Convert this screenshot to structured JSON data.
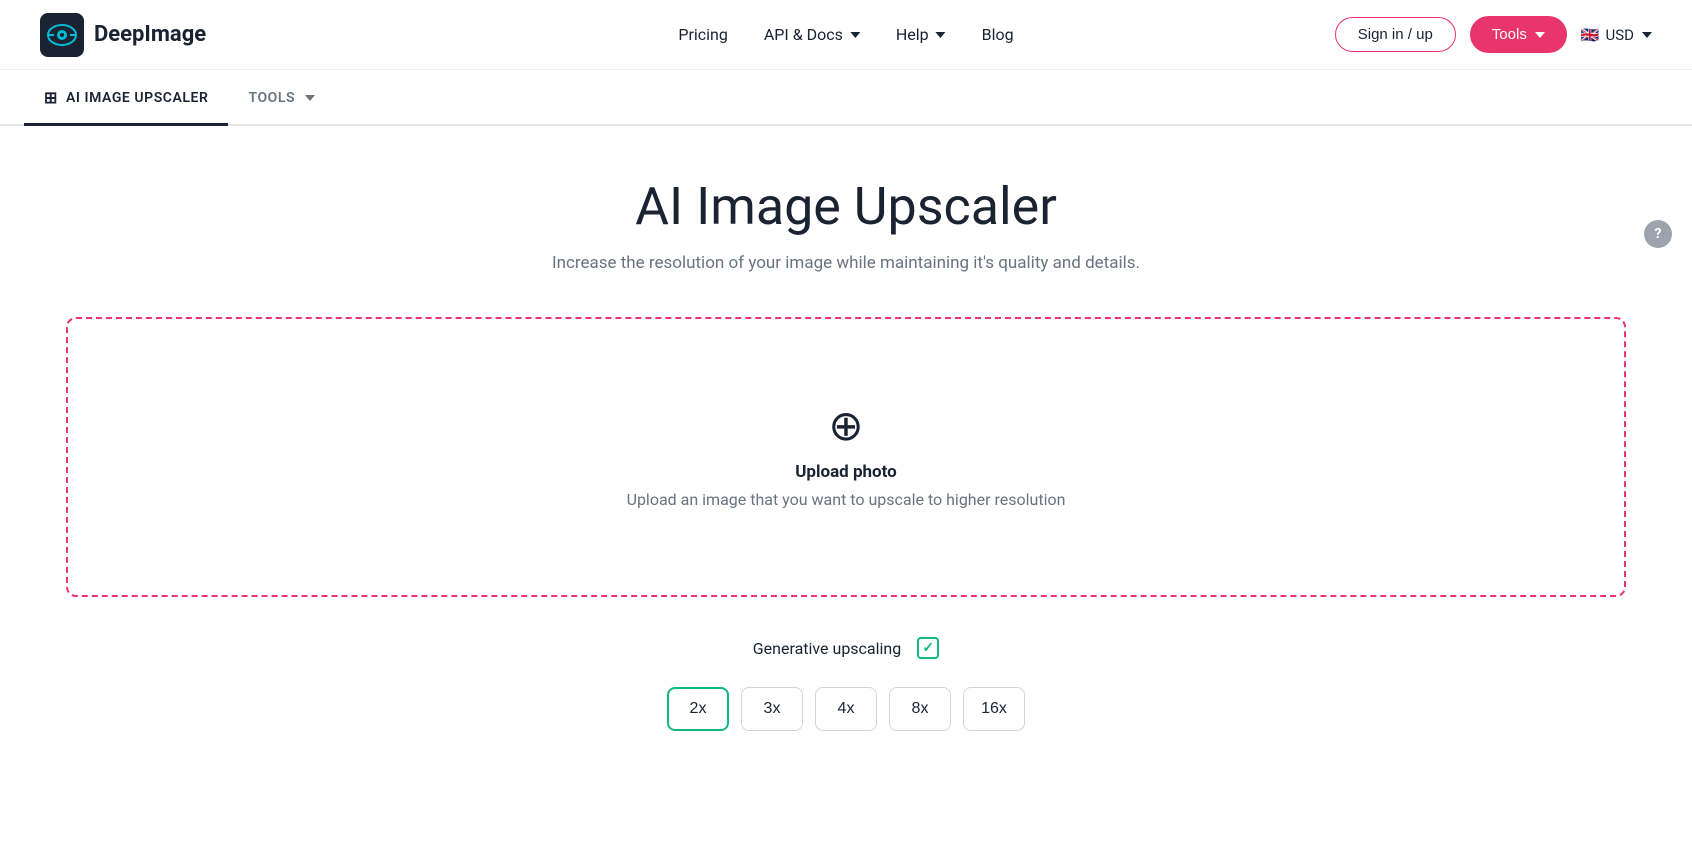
{
  "header": {
    "logo_text": "DeepImage",
    "nav": {
      "pricing": "Pricing",
      "api_docs": "API & Docs",
      "help": "Help",
      "blog": "Blog"
    },
    "signin_label": "Sign in / up",
    "tools_label": "Tools",
    "language": "USD"
  },
  "tabs": {
    "ai_upscaler_label": "AI IMAGE UPSCALER",
    "tools_label": "TOOLS"
  },
  "page": {
    "title": "AI Image Upscaler",
    "subtitle": "Increase the resolution of your image while maintaining it's quality and details.",
    "upload": {
      "icon": "⊕",
      "title": "Upload photo",
      "desc": "Upload an image that you want to upscale to higher resolution"
    },
    "generative_upscaling_label": "Generative upscaling",
    "scale_options": [
      "2x",
      "3x",
      "4x",
      "8x",
      "16x"
    ],
    "active_scale": "2x"
  },
  "help": {
    "label": "?"
  }
}
